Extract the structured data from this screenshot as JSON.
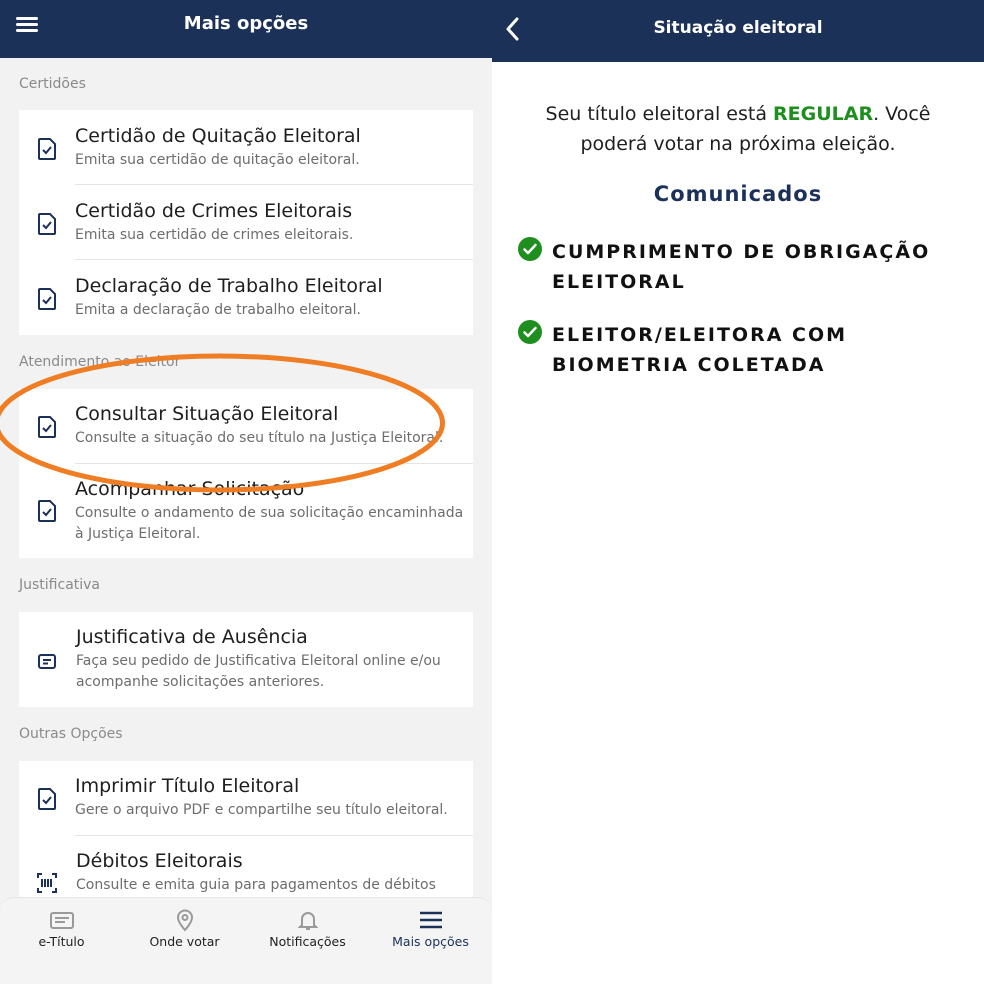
{
  "left": {
    "header": {
      "title": "Mais opções",
      "menu_icon": "hamburger-menu-icon"
    },
    "sections": [
      {
        "label": "Certidões",
        "items": [
          {
            "title": "Certidão de Quitação Eleitoral",
            "subtitle": "Emita sua certidão de quitação eleitoral.",
            "icon": "document-check-icon"
          },
          {
            "title": "Certidão de Crimes Eleitorais",
            "subtitle": "Emita sua certidão de crimes eleitorais.",
            "icon": "document-check-icon"
          },
          {
            "title": "Declaração de Trabalho Eleitoral",
            "subtitle": "Emita a declaração de trabalho eleitoral.",
            "icon": "document-check-icon"
          }
        ]
      },
      {
        "label": "Atendimento ao Eleitor",
        "items": [
          {
            "title": "Consultar Situação Eleitoral",
            "subtitle": "Consulte a situação do seu título na Justiça Eleitoral.",
            "icon": "document-check-icon"
          },
          {
            "title": "Acompanhar Solicitação",
            "subtitle": "Consulte o andamento de sua solicitação encaminhada à Justiça Eleitoral.",
            "icon": "document-check-icon"
          }
        ]
      },
      {
        "label": "Justificativa",
        "items": [
          {
            "title": "Justificativa de Ausência",
            "subtitle": "Faça seu pedido de Justificativa Eleitoral online e/ou acompanhe solicitações anteriores.",
            "icon": "message-box-icon"
          }
        ]
      },
      {
        "label": "Outras Opções",
        "items": [
          {
            "title": "Imprimir Título Eleitoral",
            "subtitle": "Gere o arquivo PDF e compartilhe seu título eleitoral.",
            "icon": "document-check-icon"
          },
          {
            "title": "Débitos Eleitorais",
            "subtitle": "Consulte e emita guia para pagamentos de débitos",
            "icon": "barcode-scan-icon"
          }
        ]
      }
    ],
    "bottom_nav": [
      {
        "label": "e-Título",
        "icon": "id-card-icon"
      },
      {
        "label": "Onde votar",
        "icon": "map-pin-icon"
      },
      {
        "label": "Notificações",
        "icon": "bell-icon"
      },
      {
        "label": "Mais opções",
        "icon": "hamburger-menu-icon"
      }
    ],
    "highlight_color": "#ef7d23"
  },
  "right": {
    "header": {
      "title": "Situação eleitoral",
      "back_icon": "chevron-left-icon"
    },
    "status": {
      "prefix": "Seu título eleitoral está ",
      "value": "REGULAR",
      "suffix": ". Você poderá votar na próxima eleição.",
      "value_color": "#1e8f1e"
    },
    "comunicados_title": "Comunicados",
    "notices": [
      {
        "text": "CUMPRIMENTO DE OBRIGAÇÃO ELEITORAL",
        "icon": "check-circle-icon"
      },
      {
        "text": "ELEITOR/ELEITORA COM BIOMETRIA COLETADA",
        "icon": "check-circle-icon"
      }
    ]
  },
  "colors": {
    "header_bg": "#1b3157",
    "success": "#1e8f1e",
    "nav_active": "#1b3157"
  }
}
